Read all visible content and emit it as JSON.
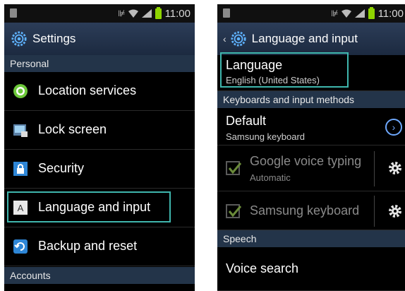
{
  "status": {
    "time": "11:00"
  },
  "left": {
    "title": "Settings",
    "sections": {
      "personal": "Personal",
      "accounts": "Accounts"
    },
    "items": [
      {
        "label": "Location services"
      },
      {
        "label": "Lock screen"
      },
      {
        "label": "Security"
      },
      {
        "label": "Language and input"
      },
      {
        "label": "Backup and reset"
      }
    ]
  },
  "right": {
    "title": "Language and input",
    "language": {
      "label": "Language",
      "value": "English (United States)"
    },
    "sections": {
      "keyboards": "Keyboards and input methods",
      "speech": "Speech"
    },
    "default": {
      "label": "Default",
      "value": "Samsung keyboard"
    },
    "google_voice": {
      "label": "Google voice typing",
      "value": "Automatic"
    },
    "samsung_keyboard": {
      "label": "Samsung keyboard"
    },
    "voice_search": {
      "label": "Voice search"
    }
  },
  "colors": {
    "highlight": "#3fb6ad",
    "section_bg": "#233449",
    "titlebar": "#2c3d58"
  }
}
